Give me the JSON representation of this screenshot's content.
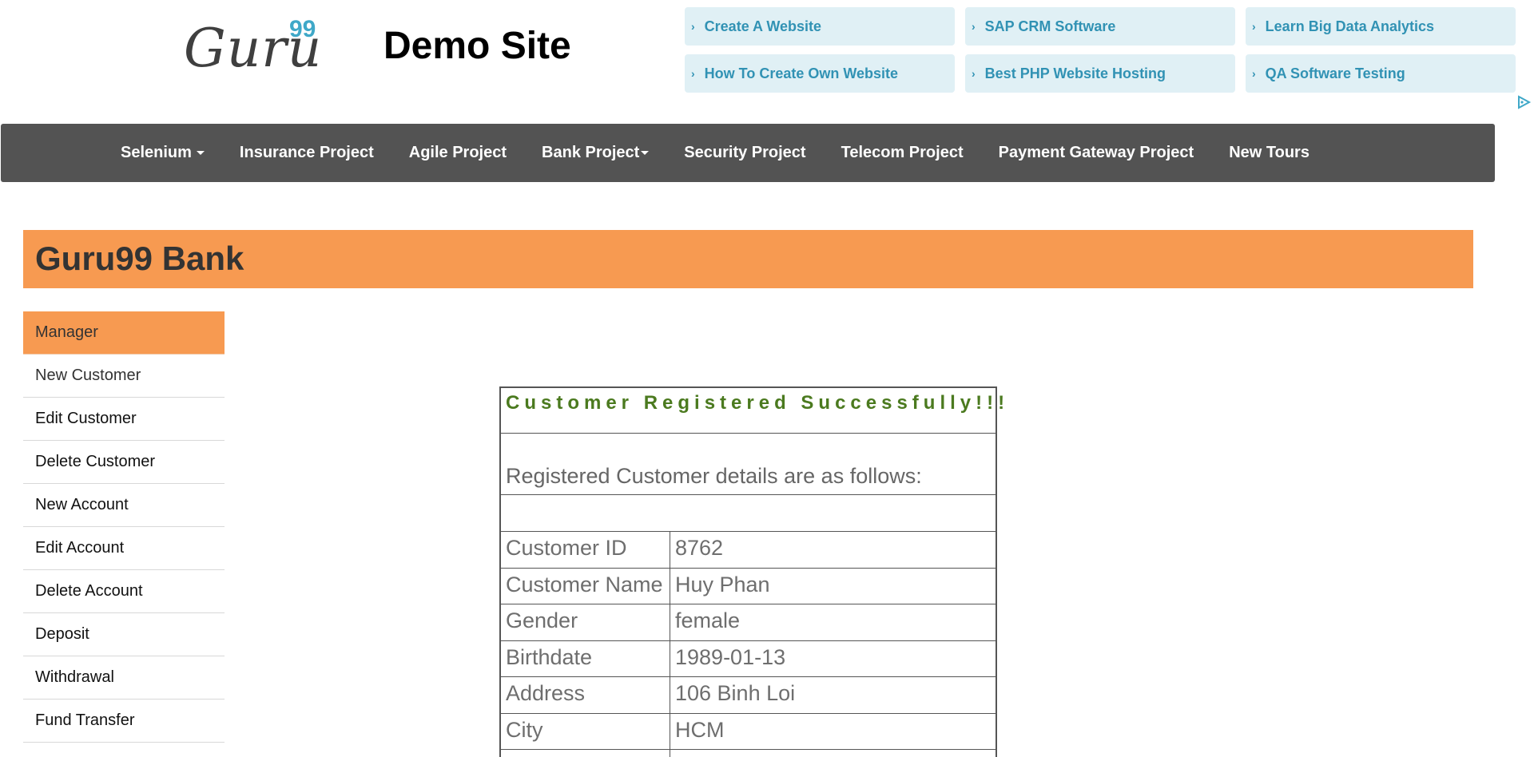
{
  "header": {
    "logo_text": "Guru",
    "logo_superscript": "99",
    "site_title": "Demo Site"
  },
  "ads": [
    {
      "label": "Create A Website"
    },
    {
      "label": "SAP CRM Software"
    },
    {
      "label": "Learn Big Data Analytics"
    },
    {
      "label": "How To Create Own Website"
    },
    {
      "label": "Best PHP Website Hosting"
    },
    {
      "label": "QA Software Testing"
    }
  ],
  "nav": {
    "items": [
      {
        "label": "Selenium",
        "dropdown": true
      },
      {
        "label": "Insurance Project",
        "dropdown": false
      },
      {
        "label": "Agile Project",
        "dropdown": false
      },
      {
        "label": "Bank Project",
        "dropdown": true
      },
      {
        "label": "Security Project",
        "dropdown": false
      },
      {
        "label": "Telecom Project",
        "dropdown": false
      },
      {
        "label": "Payment Gateway Project",
        "dropdown": false
      },
      {
        "label": "New Tours",
        "dropdown": false
      }
    ]
  },
  "banner": {
    "title": "Guru99 Bank"
  },
  "sidebar": {
    "items": [
      {
        "label": "Manager"
      },
      {
        "label": "New Customer"
      },
      {
        "label": "Edit Customer"
      },
      {
        "label": "Delete Customer"
      },
      {
        "label": "New Account"
      },
      {
        "label": "Edit Account"
      },
      {
        "label": "Delete Account"
      },
      {
        "label": "Deposit"
      },
      {
        "label": "Withdrawal"
      },
      {
        "label": "Fund Transfer"
      }
    ]
  },
  "details": {
    "success_message": "Customer Registered Successfully!!!",
    "subtitle": "Registered Customer details are as follows:",
    "rows": [
      {
        "label": "Customer ID",
        "value": "8762"
      },
      {
        "label": "Customer Name",
        "value": "Huy Phan"
      },
      {
        "label": "Gender",
        "value": "female"
      },
      {
        "label": "Birthdate",
        "value": "1989-01-13"
      },
      {
        "label": "Address",
        "value": "106 Binh Loi"
      },
      {
        "label": "City",
        "value": "HCM"
      }
    ]
  },
  "colors": {
    "accent_orange": "#f79a51",
    "navbar": "#535353",
    "ad_background": "#e0f0f5",
    "ad_text": "#3192b4",
    "success_green": "#4b7a1f"
  }
}
